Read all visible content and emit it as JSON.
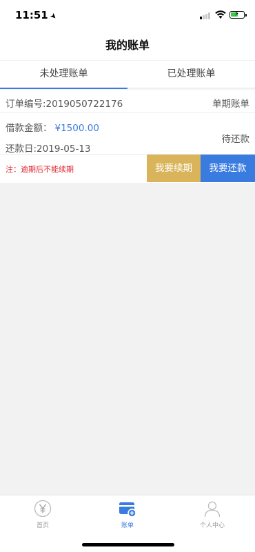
{
  "status_bar": {
    "time": "11:51"
  },
  "nav": {
    "title": "我的账单"
  },
  "tabs": [
    {
      "label": "未处理账单",
      "active": true
    },
    {
      "label": "已处理账单",
      "active": false
    }
  ],
  "bill": {
    "order_no": "订单编号:2019050722176",
    "type": "单期账单",
    "amount_label": "借款金额：",
    "amount_value": "¥1500.00",
    "due_date": "还款日:2019-05-13",
    "status": "待还款",
    "note": "注：逾期后不能续期",
    "renew_label": "我要续期",
    "pay_label": "我要还款"
  },
  "tabbar": [
    {
      "label": "首页",
      "icon": "yen-icon"
    },
    {
      "label": "账单",
      "icon": "bill-icon",
      "active": true
    },
    {
      "label": "个人中心",
      "icon": "user-icon"
    }
  ],
  "colors": {
    "accent": "#3a7be0",
    "renew": "#d9b45a",
    "warning": "#e0262f"
  }
}
